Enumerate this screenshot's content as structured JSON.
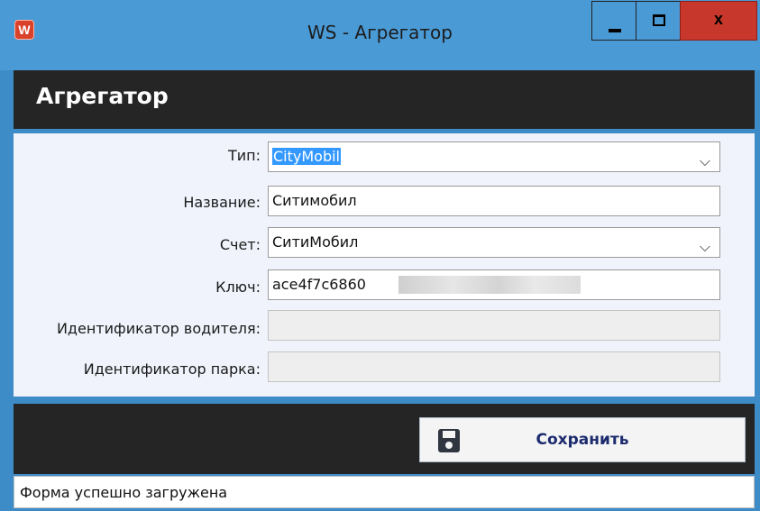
{
  "window": {
    "icon_letter": "W",
    "title": "WS - Агрегатор",
    "close_label": "x"
  },
  "header": {
    "title": "Агрегатор"
  },
  "form": {
    "fields": [
      {
        "label": "Тип:",
        "value": "CityMobil",
        "type": "select",
        "selected": true
      },
      {
        "label": "Название:",
        "value": "Ситимобил",
        "type": "text"
      },
      {
        "label": "Счет:",
        "value": "СитиМобил",
        "type": "select"
      },
      {
        "label": "Ключ:",
        "value": "ace4f7c6860",
        "type": "text",
        "redacted": true
      },
      {
        "label": "Идентификатор водителя:",
        "value": "",
        "type": "text",
        "disabled": true
      },
      {
        "label": "Идентификатор парка:",
        "value": "",
        "type": "text",
        "disabled": true
      }
    ],
    "dropdown_icon": "chevron-down-icon"
  },
  "actions": {
    "save_label": "Сохранить",
    "save_icon": "floppy-disk-icon"
  },
  "status": {
    "text": "Форма успешно загружена"
  },
  "colors": {
    "title_bar": "#4a9ad6",
    "dark_band": "#252525",
    "close_button": "#c7372b",
    "save_text": "#1c2a6e",
    "selection": "#3399ff"
  }
}
